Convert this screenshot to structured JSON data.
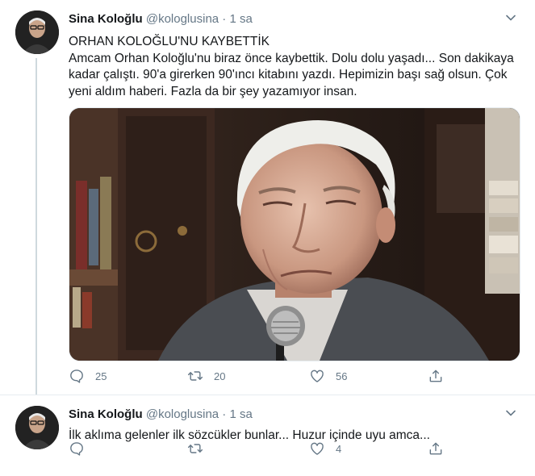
{
  "tweets": [
    {
      "author_name": "Sina Koloğlu",
      "handle": "@kologlusina",
      "separator": "·",
      "time": "1 sa",
      "text_lines": [
        "ORHAN KOLOĞLU'NU KAYBETTİK",
        "Amcam Orhan Koloğlu'nu biraz önce kaybettik. Dolu dolu yaşadı... Son dakikaya kadar çalıştı. 90'a girerken 90'ıncı kitabını yazdı. Hepimizin başı sağ olsun. Çok yeni aldım haberi. Fazla da bir şey yazamıyor insan."
      ],
      "replies": "25",
      "retweets": "20",
      "likes": "56"
    },
    {
      "author_name": "Sina Koloğlu",
      "handle": "@kologlusina",
      "separator": "·",
      "time": "1 sa",
      "text_lines": [
        "İlk aklıma gelenler ilk sözcükler bunlar... Huzur içinde uyu amca..."
      ],
      "replies": "",
      "retweets": "",
      "likes": "4"
    }
  ],
  "colors": {
    "text": "#14171a",
    "muted": "#657786",
    "thread_line": "#cfd9de"
  },
  "icons": [
    "reply-icon",
    "retweet-icon",
    "like-icon",
    "share-icon",
    "chevron-down-icon",
    "microphone"
  ]
}
